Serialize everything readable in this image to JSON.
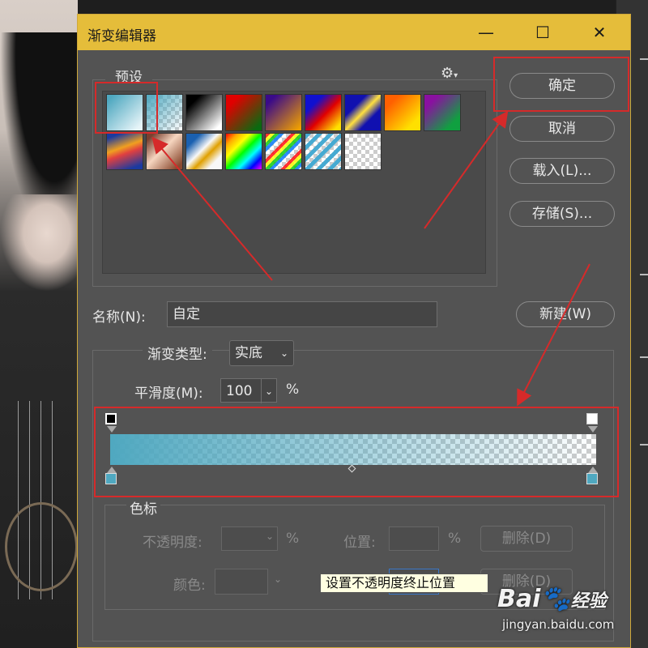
{
  "dialog": {
    "title": "渐变编辑器",
    "window_controls": [
      "—",
      "☐",
      "✕"
    ],
    "presets_label": "预设",
    "buttons": {
      "ok": "确定",
      "cancel": "取消",
      "load": "载入(L)...",
      "save": "存储(S)...",
      "new": "新建(W)"
    },
    "name_label": "名称(N):",
    "name_value": "自定",
    "gradient_type_label": "渐变类型:",
    "gradient_type_value": "实底",
    "smoothness_label": "平滑度(M):",
    "smoothness_value": "100",
    "percent": "%",
    "stops_label": "色标",
    "opacity_label": "不透明度:",
    "location_label": "位置:",
    "color_label": "颜色:",
    "delete_label": "删除(D)",
    "tooltip": "设置不透明度终止位置"
  },
  "watermark": {
    "brand": "Bai",
    "brand_tail": "经验",
    "url": "jingyan.baidu.com"
  },
  "colors": {
    "title_bar": "#e5bd3a",
    "dialog_bg": "#535353",
    "accent_stop": "#4fa8c0",
    "annotation": "#d62a2a"
  }
}
